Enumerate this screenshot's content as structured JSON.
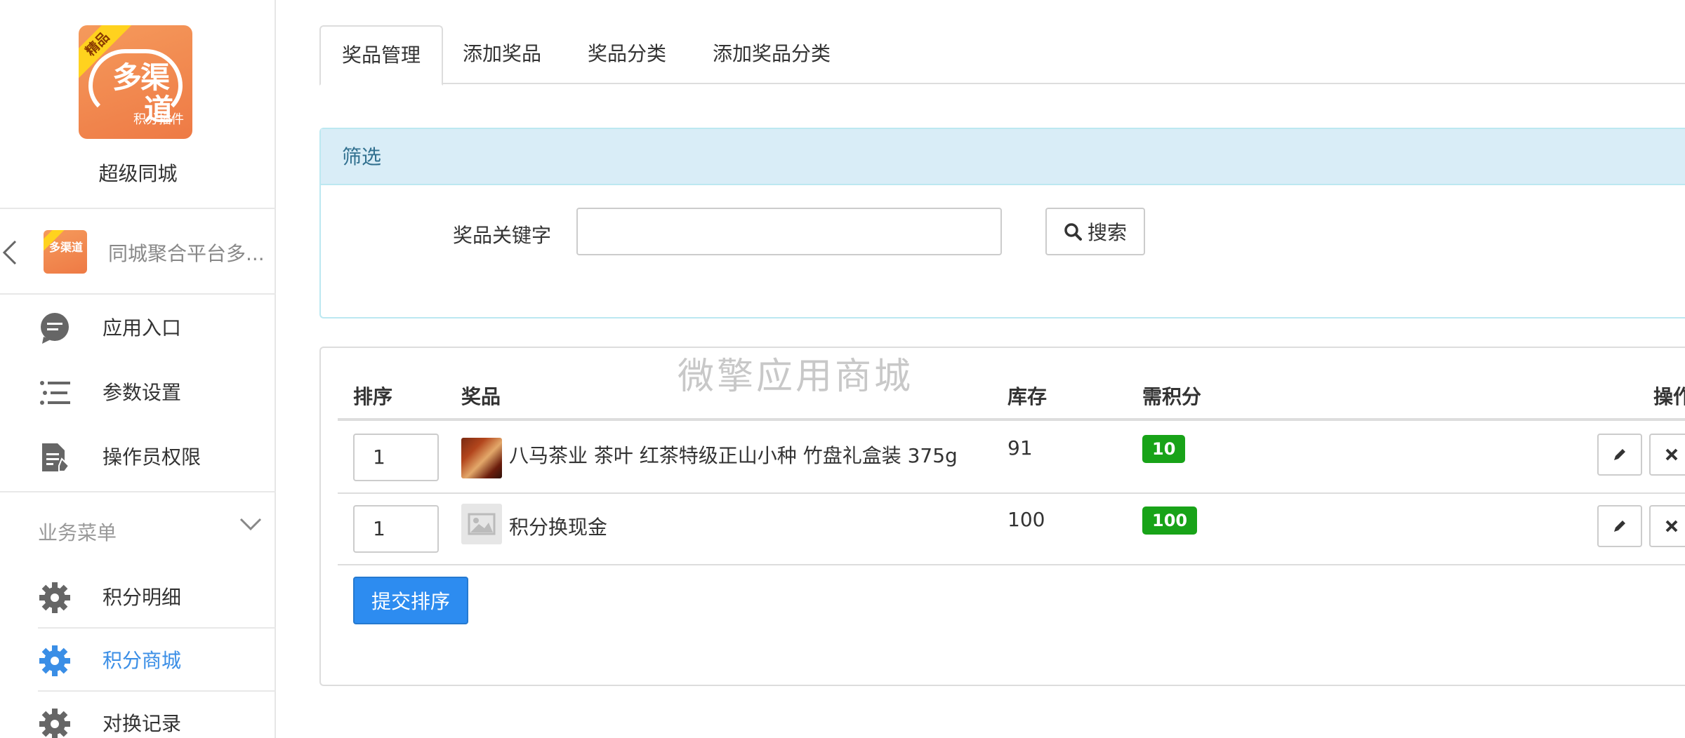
{
  "sidebar": {
    "logo": {
      "corner": "精品",
      "big_line1": "多渠",
      "big_line2": "道",
      "small": "积分插件"
    },
    "app_title": "超级同城",
    "back": {
      "label": "同城聚合平台多..."
    },
    "mini_logo": {
      "text": "多渠道"
    },
    "menu_top": [
      {
        "label": "应用入口",
        "icon": "chat-icon"
      },
      {
        "label": "参数设置",
        "icon": "list-icon"
      },
      {
        "label": "操作员权限",
        "icon": "document-edit-icon"
      }
    ],
    "section_title": "业务菜单",
    "menu_biz": [
      {
        "label": "积分明细",
        "icon": "gear-icon"
      },
      {
        "label": "积分商城",
        "icon": "gear-icon",
        "active": true
      },
      {
        "label": "对换记录",
        "icon": "gear-icon"
      }
    ]
  },
  "tabs": [
    {
      "label": "奖品管理",
      "active": true
    },
    {
      "label": "添加奖品"
    },
    {
      "label": "奖品分类"
    },
    {
      "label": "添加奖品分类"
    }
  ],
  "filter": {
    "title": "筛选",
    "keyword_label": "奖品关键字",
    "keyword_value": "",
    "search_label": "搜索"
  },
  "watermark": "微擎应用商城",
  "table": {
    "headers": {
      "sort": "排序",
      "prize": "奖品",
      "stock": "库存",
      "points": "需积分",
      "actions": "操作"
    },
    "rows": [
      {
        "sort": "1",
        "name": "八马茶业 茶叶 红茶特级正山小种 竹盘礼盒装 375g",
        "stock": "91",
        "points": "10",
        "thumb": "tea"
      },
      {
        "sort": "1",
        "name": "积分换现金",
        "stock": "100",
        "points": "100",
        "thumb": "placeholder"
      }
    ],
    "submit_label": "提交排序"
  },
  "colors": {
    "accent": "#2d8cf0",
    "active_menu": "#3a8ee6",
    "badge": "#18a318",
    "filter_bg": "#d9edf7",
    "logo": "#ee7a45"
  }
}
